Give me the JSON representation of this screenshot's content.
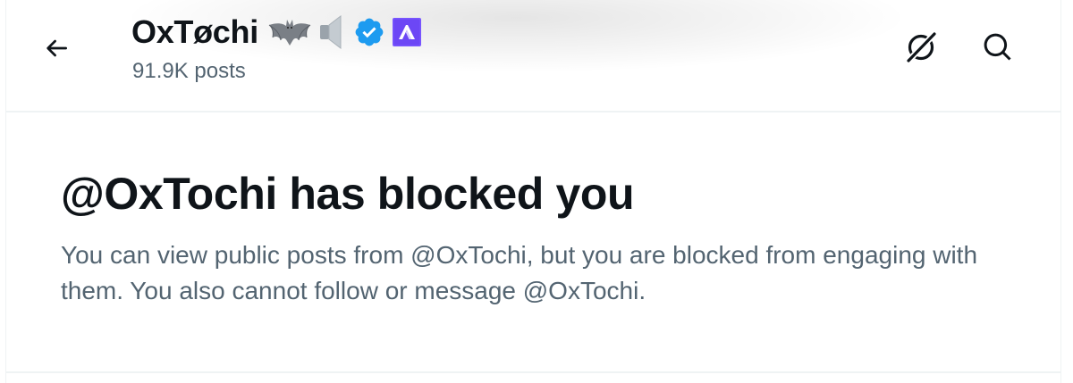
{
  "header": {
    "display_name": "OxTøchi",
    "posts_count": "91.9K posts",
    "name_emojis": [
      "bat-emoji",
      "speaker-emoji"
    ],
    "badges": [
      "verified-badge",
      "affiliate-badge"
    ],
    "colors": {
      "verified": "#1d9bf0",
      "affiliate": "#7856ff",
      "text_primary": "#0f1419",
      "text_secondary": "#536471"
    }
  },
  "icons": {
    "back": "arrow-left-icon",
    "grok": "grok-icon",
    "search": "search-icon"
  },
  "blocked": {
    "title": "@OxTochi has blocked you",
    "message": "You can view public posts from @OxTochi, but you are blocked from engaging with them. You also cannot follow or message @OxTochi."
  }
}
